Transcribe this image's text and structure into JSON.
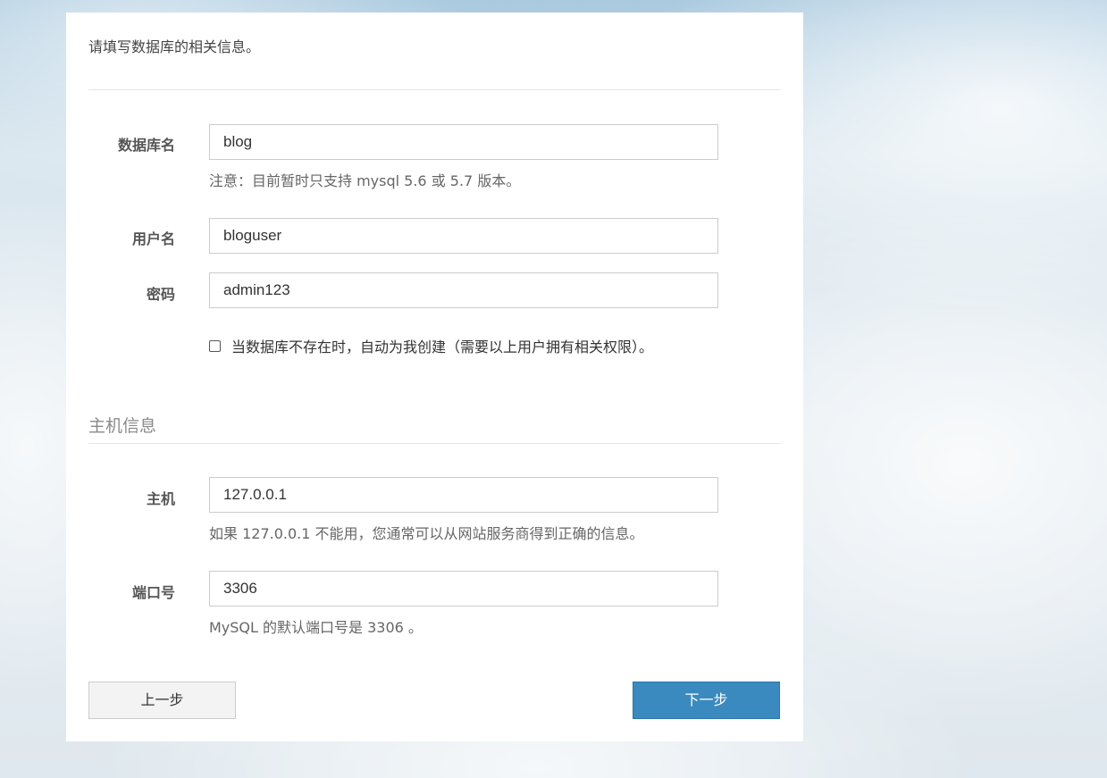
{
  "intro": "请填写数据库的相关信息。",
  "database": {
    "name_label": "数据库名",
    "name_value": "blog",
    "name_hint": "注意：目前暂时只支持 mysql 5.6 或 5.7 版本。",
    "user_label": "用户名",
    "user_value": "bloguser",
    "password_label": "密码",
    "password_value": "admin123",
    "auto_create_label": "当数据库不存在时，自动为我创建（需要以上用户拥有相关权限）。",
    "auto_create_checked": false
  },
  "host_section": {
    "title": "主机信息",
    "host_label": "主机",
    "host_value": "127.0.0.1",
    "host_hint": "如果 127.0.0.1 不能用，您通常可以从网站服务商得到正确的信息。",
    "port_label": "端口号",
    "port_value": "3306",
    "port_hint": "MySQL 的默认端口号是 3306 。"
  },
  "buttons": {
    "prev": "上一步",
    "next": "下一步"
  },
  "colors": {
    "primary": "#3a8abf",
    "secondary": "#f3f3f3"
  }
}
